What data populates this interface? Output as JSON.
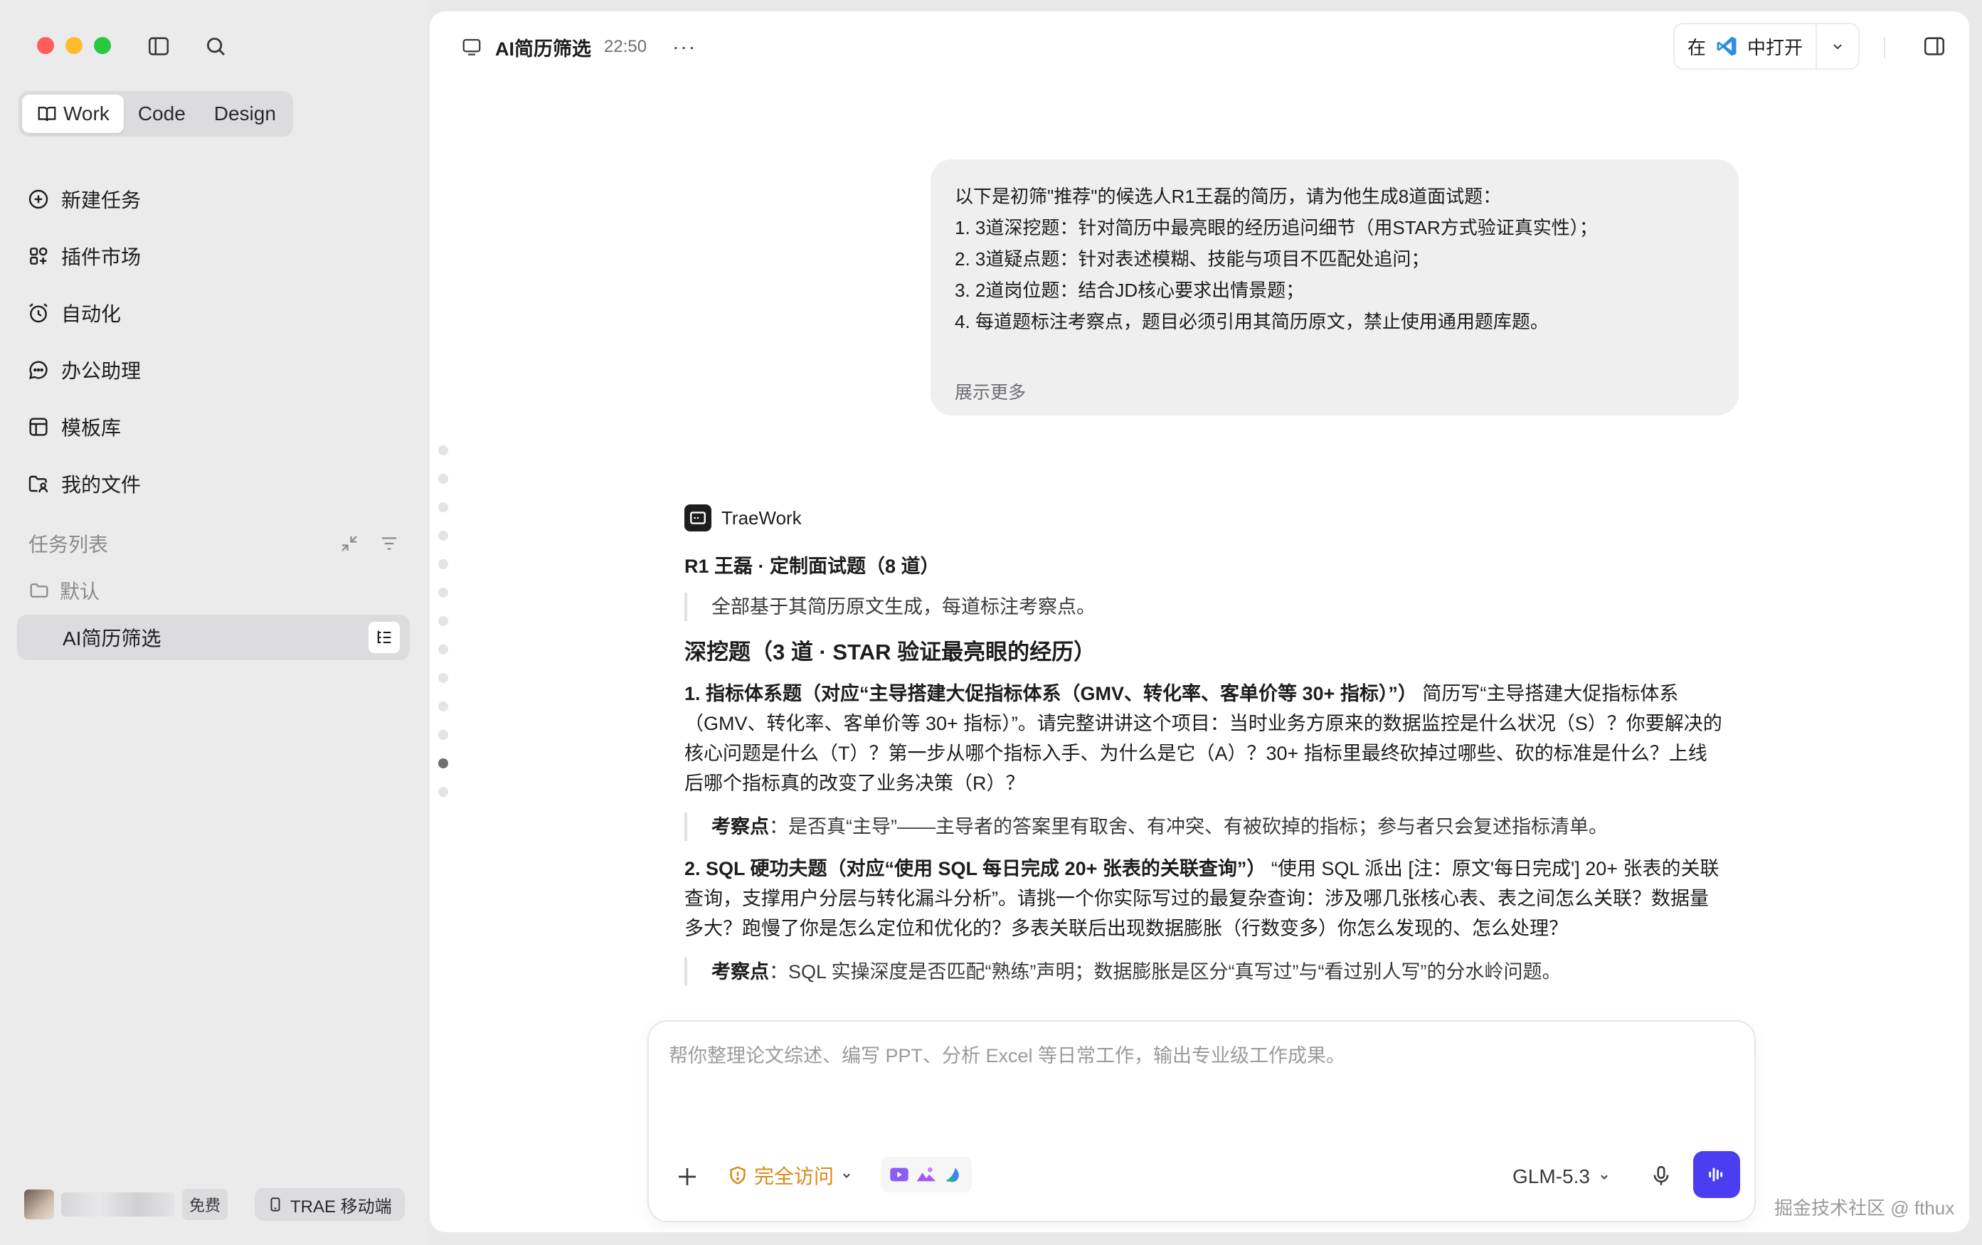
{
  "sidebar": {
    "modes": [
      {
        "label": "Work",
        "active": true
      },
      {
        "label": "Code",
        "active": false
      },
      {
        "label": "Design",
        "active": false
      }
    ],
    "nav": [
      {
        "label": "新建任务",
        "icon": "plus-circle-icon"
      },
      {
        "label": "插件市场",
        "icon": "plugin-grid-icon"
      },
      {
        "label": "自动化",
        "icon": "alarm-clock-icon"
      },
      {
        "label": "办公助理",
        "icon": "chat-bubble-icon"
      },
      {
        "label": "模板库",
        "icon": "template-icon"
      },
      {
        "label": "我的文件",
        "icon": "folder-user-icon"
      }
    ],
    "tasks_header": "任务列表",
    "folder": "默认",
    "task_item": "AI简历筛选",
    "plan_badge": "免费",
    "mobile_button": "TRAE 移动端"
  },
  "header": {
    "title": "AI简历筛选",
    "time": "22:50",
    "more": "···",
    "open_in_prefix": "在",
    "open_in_suffix": "中打开"
  },
  "user_message": {
    "lines": [
      "以下是初筛\"推荐\"的候选人R1王磊的简历，请为他生成8道面试题：",
      "1. 3道深挖题：针对简历中最亮眼的经历追问细节（用STAR方式验证真实性）；",
      "2. 3道疑点题：针对表述模糊、技能与项目不匹配处追问；",
      "3. 2道岗位题：结合JD核心要求出情景题；",
      "4. 每道题标注考察点，题目必须引用其简历原文，禁止使用通用题库题。"
    ],
    "show_more": "展示更多"
  },
  "assistant": {
    "name": "TraeWork",
    "title": "R1 王磊 · 定制面试题（8 道）",
    "intro": "全部基于其简历原文生成，每道标注考察点。",
    "section": "深挖题（3 道 · STAR 验证最亮眼的经历）",
    "q1_title": "1. 指标体系题（对应“主导搭建大促指标体系（GMV、转化率、客单价等 30+ 指标）”）",
    "q1_body": " 简历写“主导搭建大促指标体系（GMV、转化率、客单价等 30+ 指标）”。请完整讲讲这个项目：当时业务方原来的数据监控是什么状况（S）？你要解决的核心问题是什么（T）？第一步从哪个指标入手、为什么是它（A）？30+ 指标里最终砍掉过哪些、砍的标准是什么？上线后哪个指标真的改变了业务决策（R）？",
    "q1_point_label": "考察点",
    "q1_point": "：是否真“主导”——主导者的答案里有取舍、有冲突、有被砍掉的指标；参与者只会复述指标清单。",
    "q2_title": "2. SQL 硬功夫题（对应“使用 SQL 每日完成 20+ 张表的关联查询”）",
    "q2_body": " “使用 SQL 派出 [注：原文'每日完成'] 20+ 张表的关联查询，支撑用户分层与转化漏斗分析”。请挑一个你实际写过的最复杂查询：涉及哪几张核心表、表之间怎么关联？数据量多大？跑慢了你是怎么定位和优化的？多表关联后出现数据膨胀（行数变多）你怎么发现的、怎么处理？",
    "q2_point_label": "考察点",
    "q2_point": "：SQL 实操深度是否匹配“熟练”声明；数据膨胀是区分“真写过”与“看过别人写”的分水岭问题。"
  },
  "composer": {
    "placeholder": "帮你整理论文综述、编写 PPT、分析 Excel 等日常工作，输出专业级工作成果。",
    "access_label": "完全访问",
    "model": "GLM-5.3"
  },
  "watermark": "掘金技术社区 @ fthux",
  "colors": {
    "accent": "#4b3ef0",
    "warning": "#d88a16"
  }
}
